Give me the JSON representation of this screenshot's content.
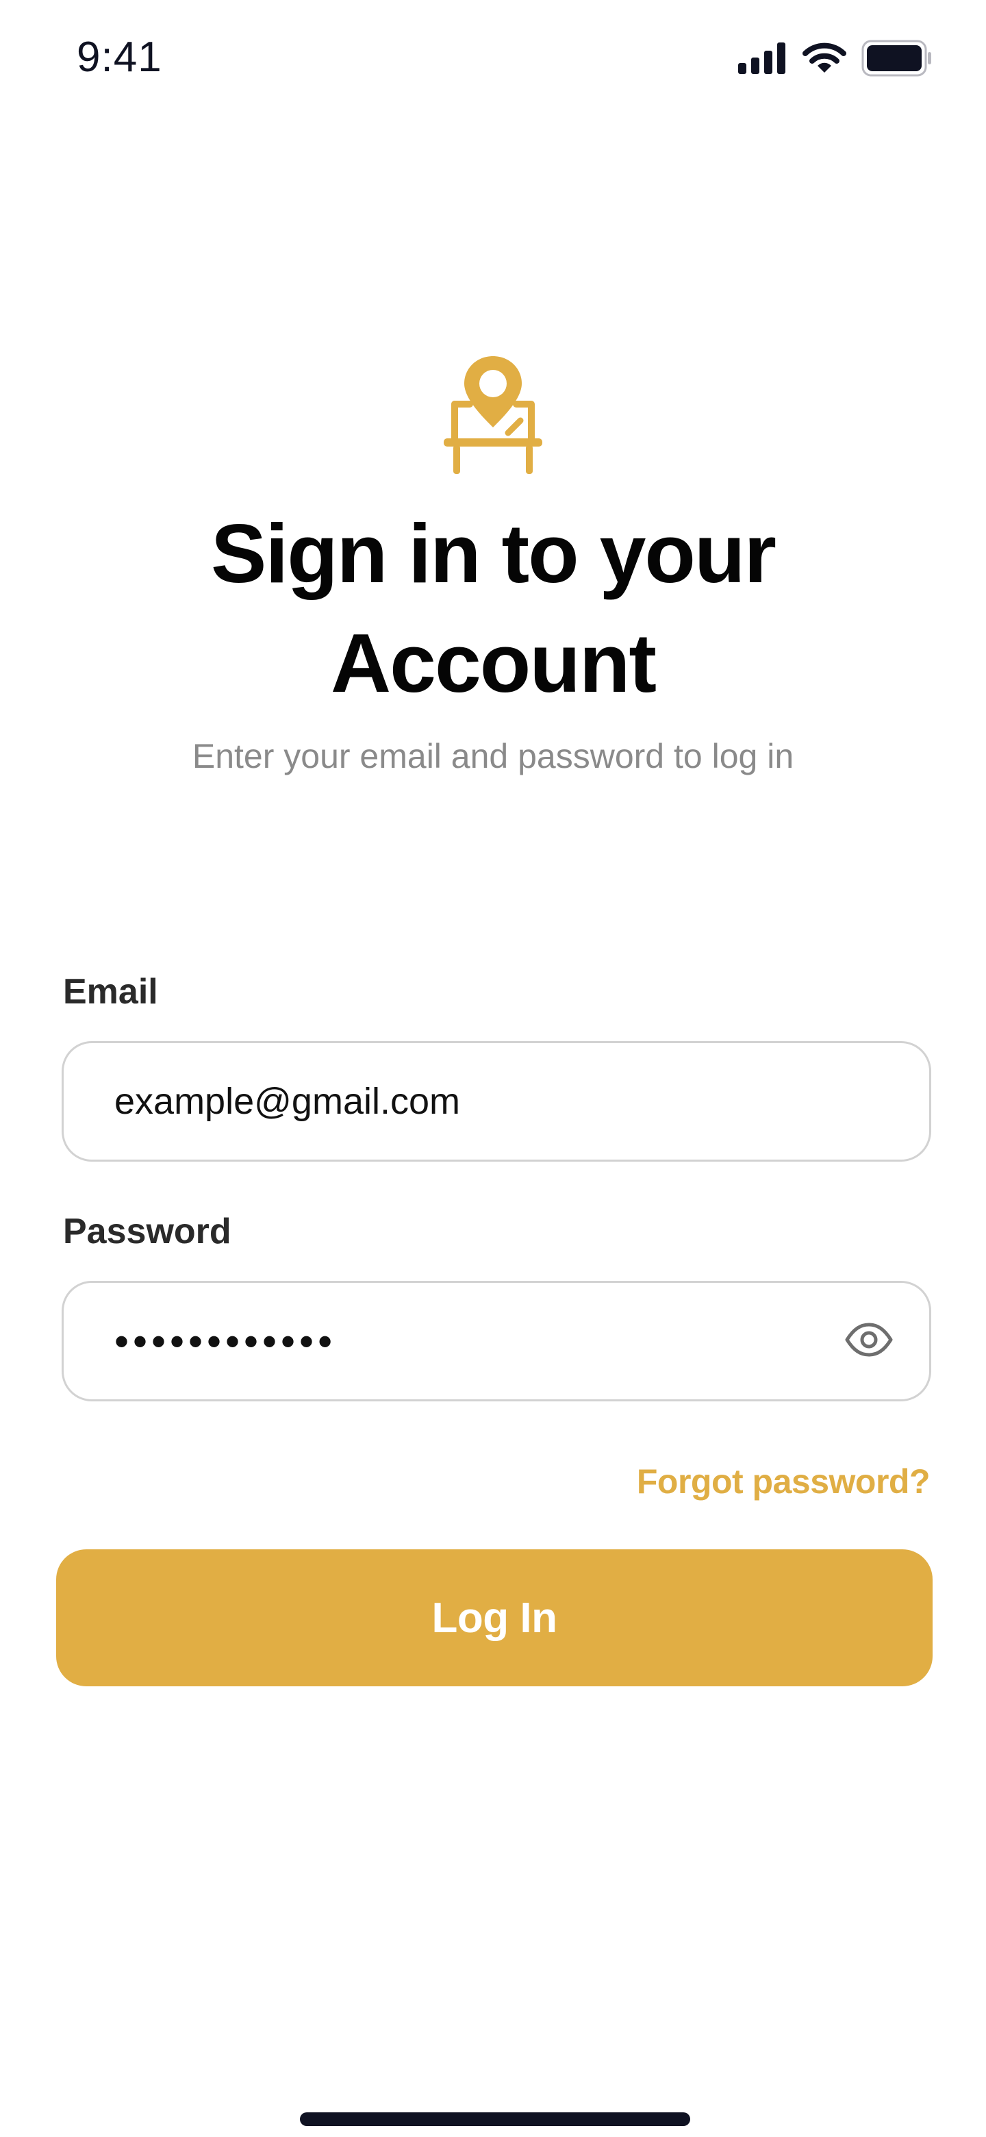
{
  "status_bar": {
    "time": "9:41",
    "icons": [
      "cellular-signal-icon",
      "wifi-icon",
      "battery-icon"
    ]
  },
  "header": {
    "logo_icon": "map-pin-desk-icon",
    "title_line1": "Sign in to your",
    "title_line2": "Account",
    "subtitle": "Enter your email and password to log in"
  },
  "form": {
    "email": {
      "label": "Email",
      "value": "example@gmail.com"
    },
    "password": {
      "label": "Password",
      "value": "••••••••••••",
      "toggle_icon": "eye-icon"
    },
    "forgot_password": "Forgot password?",
    "login_button": "Log In"
  },
  "colors": {
    "accent": "#E1AE44",
    "title": "#050505",
    "subtitle": "#8A8A8A",
    "border": "#D2D2D2",
    "status_dark": "#0F1222"
  }
}
